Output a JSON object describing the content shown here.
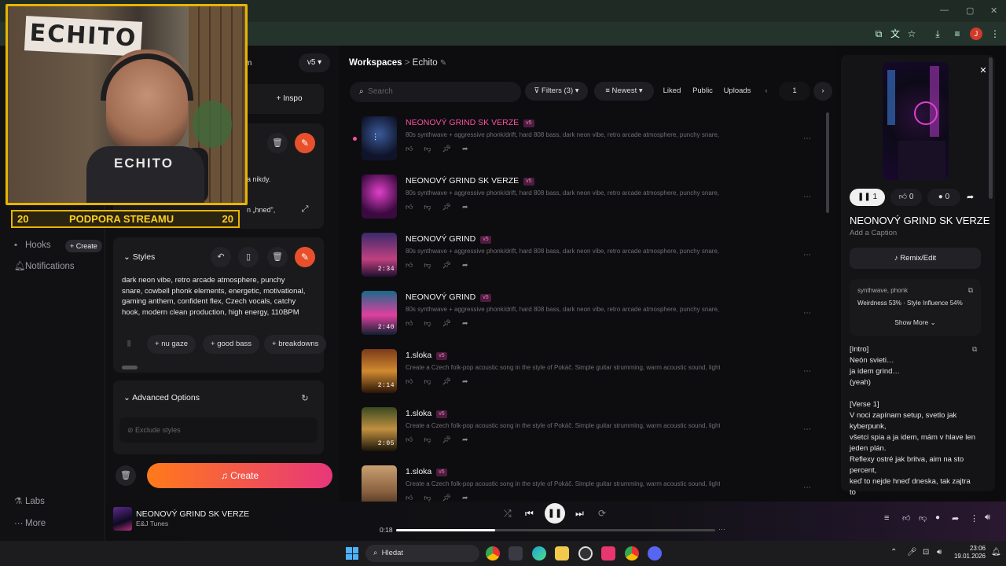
{
  "browser": {
    "window_controls": [
      "—",
      "▢",
      "✕"
    ]
  },
  "sidebar": {
    "hooks": "Hooks",
    "create": "+ Create",
    "notifications": "Notifications",
    "labs": "Labs",
    "more": "More"
  },
  "create_panel": {
    "version": "v5 ▾",
    "inspo": "Inspo",
    "partial_m": "m",
    "lyrics_fragment1": "a nikdy.",
    "lyrics_fragment2": "n „hned\",",
    "styles_label": "Styles",
    "styles_text": "dark neon vibe, retro arcade atmosphere, punchy snare, cowbell phonk elements, energetic, motivational, gaming anthem, confident flex, Czech vocals, catchy hook, modern clean production, high energy, 110BPM",
    "chips": [
      "nu gaze",
      "good bass",
      "breakdowns"
    ],
    "advanced": "Advanced Options",
    "exclude": "Exclude styles",
    "create_button": "Create"
  },
  "workspace": {
    "breadcrumb_root": "Workspaces",
    "breadcrumb_sep": ">",
    "breadcrumb_current": "Echito",
    "search_placeholder": "Search",
    "filters": "Filters (3)",
    "sort": "Newest",
    "liked": "Liked",
    "public": "Public",
    "uploads": "Uploads",
    "page": "1",
    "songs": [
      {
        "title": "NEONOVÝ GRIND SK VERZE",
        "version": "v5",
        "desc": "80s synthwave + aggressive phonk/drift, hard 808 bass, dark neon vibe, retro arcade atmosphere, punchy snare, co...",
        "duration": "",
        "active": true
      },
      {
        "title": "NEONOVÝ GRIND SK VERZE",
        "version": "v5",
        "desc": "80s synthwave + aggressive phonk/drift, hard 808 bass, dark neon vibe, retro arcade atmosphere, punchy snare, co...",
        "duration": "",
        "active": false
      },
      {
        "title": "NEONOVÝ GRIND",
        "version": "v5",
        "desc": "80s synthwave + aggressive phonk/drift, hard 808 bass, dark neon vibe, retro arcade atmosphere, punchy snare, co...",
        "duration": "2:34",
        "active": false
      },
      {
        "title": "NEONOVÝ GRIND",
        "version": "v5",
        "desc": "80s synthwave + aggressive phonk/drift, hard 808 bass, dark neon vibe, retro arcade atmosphere, punchy snare, co...",
        "duration": "2:40",
        "active": false
      },
      {
        "title": "1.sloka",
        "version": "v5",
        "desc": "Create a Czech folk-pop acoustic song in the style of Pokáč. Simple guitar strumming, warm acoustic sound, light pe...",
        "duration": "2:14",
        "active": false
      },
      {
        "title": "1.sloka",
        "version": "v5",
        "desc": "Create a Czech folk-pop acoustic song in the style of Pokáč. Simple guitar strumming, warm acoustic sound, light pe...",
        "duration": "2:05",
        "active": false
      },
      {
        "title": "1.sloka",
        "version": "v5",
        "desc": "Create a Czech folk-pop acoustic song in the style of Pokáč. Simple guitar strumming, warm acoustic sound, light pe...",
        "duration": "",
        "active": false
      }
    ]
  },
  "detail": {
    "play_count": "1",
    "likes": "0",
    "comments": "0",
    "title": "NEONOVÝ GRIND SK VERZE",
    "caption": "Add a Caption",
    "remix": "Remix/Edit",
    "tags": "synthwave, phonk",
    "weirdness": "Weirdness 53% · Style Influence 54%",
    "show_more": "Show More",
    "lyrics": "[Intro]\nNeón svieti…\nja idem grind…\n(yeah)\n\n[Verse 1]\nV noci zapínam setup, svetlo jak kyberpunk,\nvšetci spia a ja idem, mám v hlave len jeden plán.\nReflexy ostré jak britva, aim na sto percent,\nkeď to nejde hneď dneska, tak zajtra to"
  },
  "player": {
    "title": "NEONOVÝ GRIND SK VERZE",
    "artist": "E&J Tunes",
    "elapsed": "0:18",
    "progress": 0.31
  },
  "webcam": {
    "sign": "ECHITO",
    "shirt": "ECHITO",
    "banner_left": "20",
    "banner_text": "PODPORA STREAMU",
    "banner_right": "20"
  },
  "taskbar": {
    "search": "Hledat",
    "time": "23:06",
    "date": "19.01.2026"
  }
}
